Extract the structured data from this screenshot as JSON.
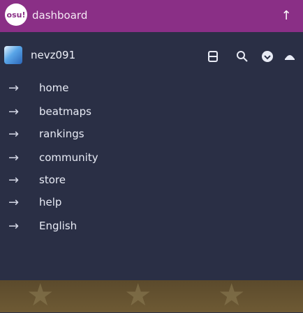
{
  "topbar": {
    "logo_text": "osu!",
    "title": "dashboard",
    "up_icon": "arrow-up-icon"
  },
  "userbar": {
    "username": "nevz091",
    "icons": [
      "chat-icon",
      "search-icon",
      "notifications-icon",
      "theme-icon"
    ]
  },
  "nav": {
    "items": [
      {
        "label": "home"
      },
      {
        "label": "beatmaps"
      },
      {
        "label": "rankings"
      },
      {
        "label": "community"
      },
      {
        "label": "store"
      },
      {
        "label": "help"
      },
      {
        "label": "English"
      }
    ]
  },
  "colors": {
    "topbar": "#8a2f86",
    "background": "#2a2f45",
    "footer": "#6e5a34"
  }
}
